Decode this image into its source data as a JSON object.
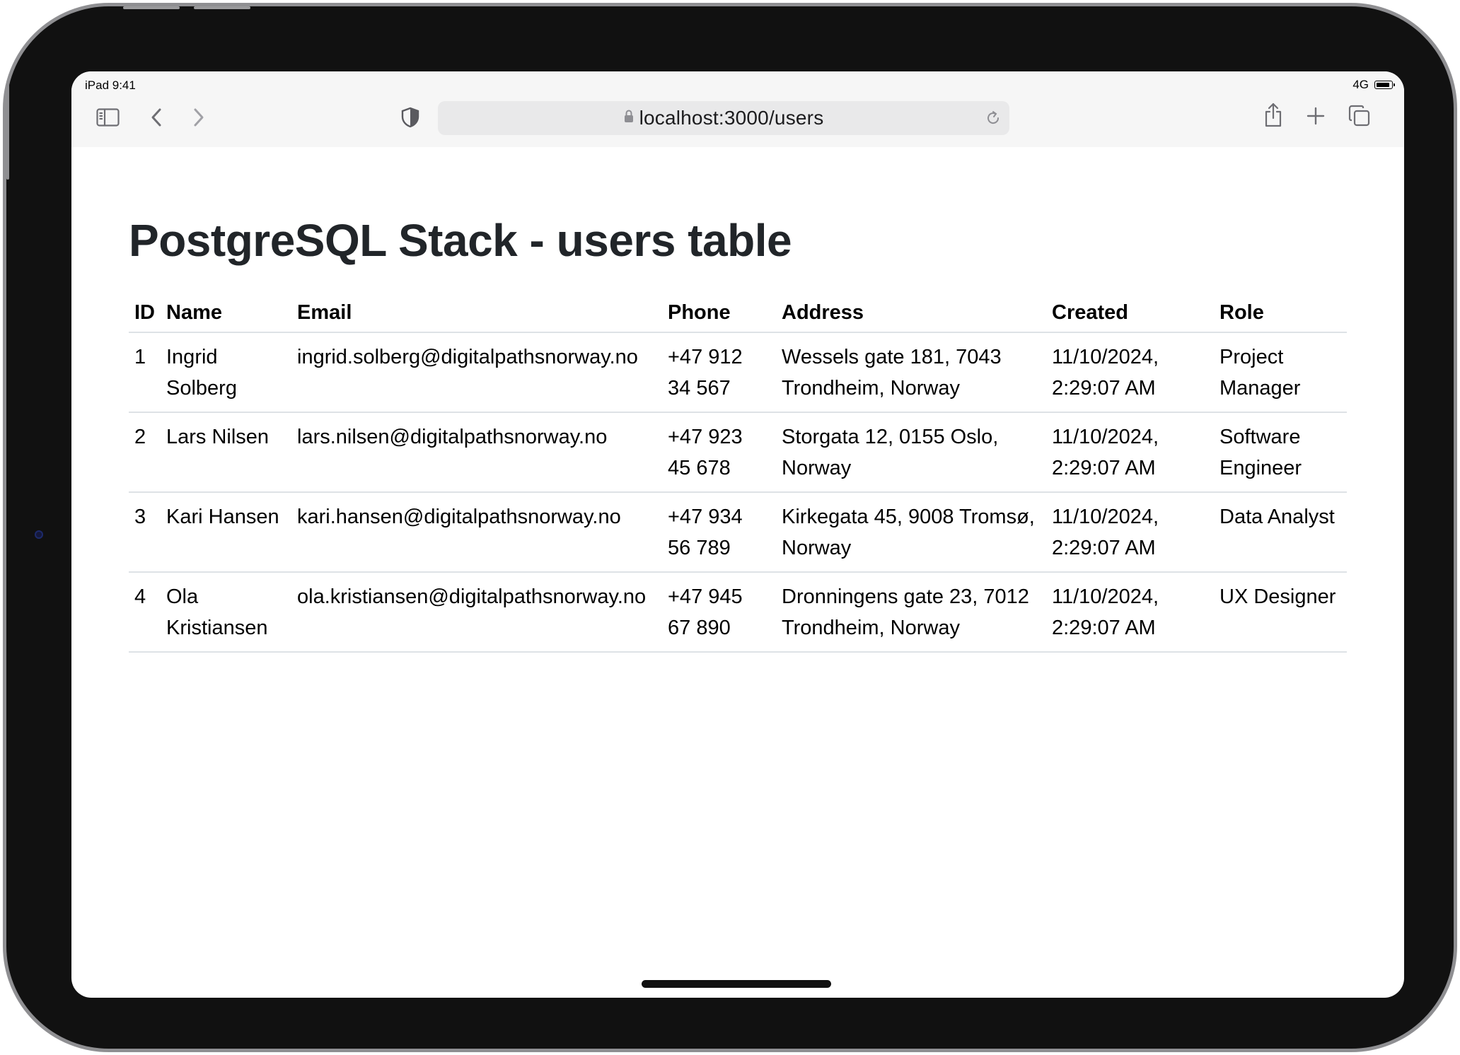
{
  "status_bar": {
    "time": "iPad 9:41",
    "network": "4G"
  },
  "browser": {
    "url": "localhost:3000/users",
    "icons": [
      "sidebar-icon",
      "back-icon",
      "forward-icon",
      "privacy-shield-icon",
      "lock-icon",
      "reload-icon",
      "share-icon",
      "new-tab-icon",
      "tabs-overview-icon"
    ]
  },
  "page": {
    "title": "PostgreSQL Stack - users table",
    "table": {
      "headers": {
        "id": "ID",
        "name": "Name",
        "email": "Email",
        "phone": "Phone",
        "address": "Address",
        "created": "Created",
        "role": "Role"
      },
      "rows": [
        {
          "id": "1",
          "name": "Ingrid Solberg",
          "email": "ingrid.solberg@digitalpathsnorway.no",
          "phone": "+47 912 34 567",
          "address": "Wessels gate 181, 7043 Trondheim, Norway",
          "created": "11/10/2024, 2:29:07 AM",
          "role": "Project Manager"
        },
        {
          "id": "2",
          "name": "Lars Nilsen",
          "email": "lars.nilsen@digitalpathsnorway.no",
          "phone": "+47 923 45 678",
          "address": "Storgata 12, 0155 Oslo, Norway",
          "created": "11/10/2024, 2:29:07 AM",
          "role": "Software Engineer"
        },
        {
          "id": "3",
          "name": "Kari Hansen",
          "email": "kari.hansen@digitalpathsnorway.no",
          "phone": "+47 934 56 789",
          "address": "Kirkegata 45, 9008 Tromsø, Norway",
          "created": "11/10/2024, 2:29:07 AM",
          "role": "Data Analyst"
        },
        {
          "id": "4",
          "name": "Ola Kristiansen",
          "email": "ola.kristiansen@digitalpathsnorway.no",
          "phone": "+47 945 67 890",
          "address": "Dronningens gate 23, 7012 Trondheim, Norway",
          "created": "11/10/2024, 2:29:07 AM",
          "role": "UX Designer"
        }
      ]
    }
  }
}
